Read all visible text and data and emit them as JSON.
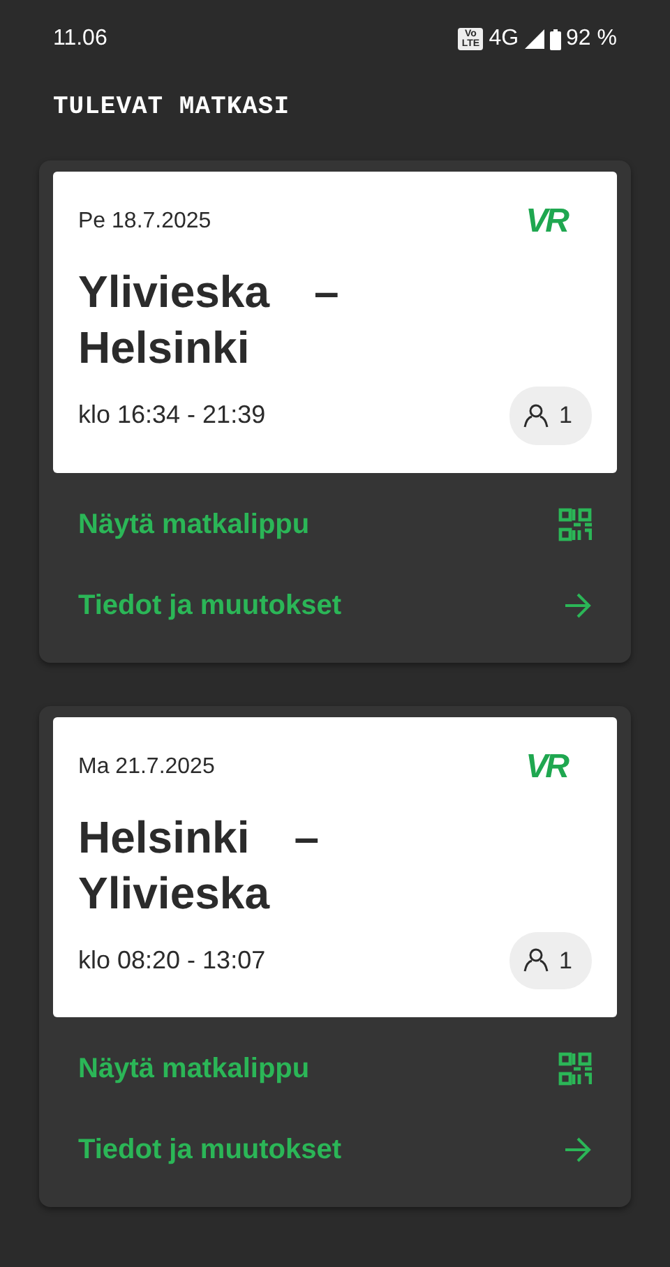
{
  "status_bar": {
    "time": "11.06",
    "volte": "Vo LTE",
    "network": "4G",
    "battery": "92 %"
  },
  "title": "TULEVAT MATKASI",
  "trips": [
    {
      "date": "Pe 18.7.2025",
      "logo": "VR",
      "origin": "Ylivieska",
      "dash": "–",
      "destination": "Helsinki",
      "time": "klo 16:34 - 21:39",
      "passengers": "1",
      "actions": [
        {
          "kind": "ticket",
          "label": "Näytä matkalippu"
        },
        {
          "kind": "details",
          "label": "Tiedot ja muutokset"
        }
      ]
    },
    {
      "date": "Ma 21.7.2025",
      "logo": "VR",
      "origin": "Helsinki",
      "dash": "–",
      "destination": "Ylivieska",
      "time": "klo 08:20 - 13:07",
      "passengers": "1",
      "actions": [
        {
          "kind": "ticket",
          "label": "Näytä matkalippu"
        },
        {
          "kind": "details",
          "label": "Tiedot ja muutokset"
        }
      ]
    }
  ]
}
